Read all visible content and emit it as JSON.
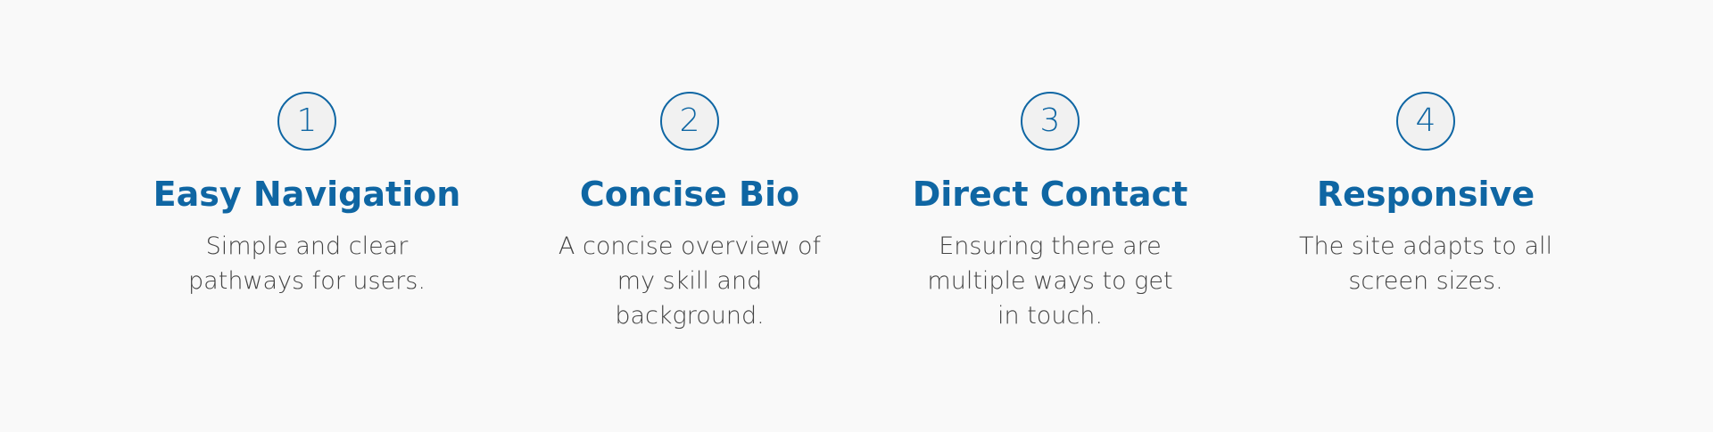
{
  "theme": {
    "accent": "#0f66a3",
    "text": "#444444",
    "background": "#f9f9f9",
    "circle_fill": "#f1f1f1"
  },
  "features": [
    {
      "number": "1",
      "title": "Easy Navigation",
      "description": "Simple and clear pathways for users."
    },
    {
      "number": "2",
      "title": "Concise Bio",
      "description": "A concise overview of my skill and background."
    },
    {
      "number": "3",
      "title": "Direct Contact",
      "description": "Ensuring there are multiple ways to get in touch."
    },
    {
      "number": "4",
      "title": "Responsive",
      "description": "The site adapts to all screen sizes."
    }
  ]
}
